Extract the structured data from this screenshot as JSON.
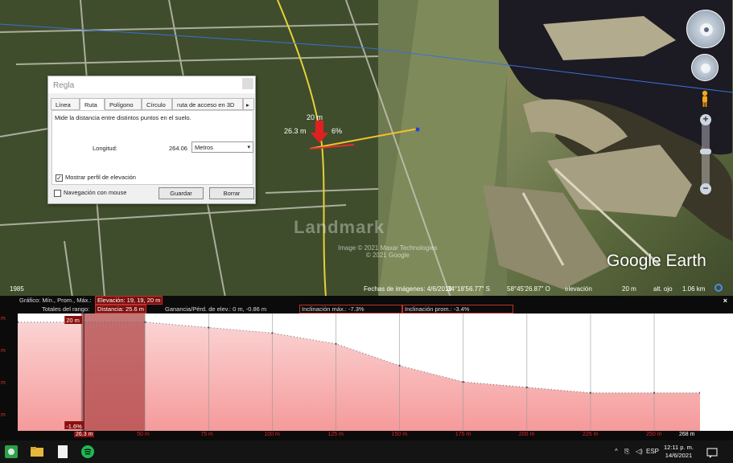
{
  "map": {
    "year": "1985",
    "attribution_line1": "Image © 2021 Maxar Technologies",
    "attribution_line2": "© 2021 Google",
    "watermark": "Landmark",
    "brand": "Google Earth",
    "status_date": "Fechas de imágenes: 4/6/2019",
    "status_lat": "34°18'56.77\" S",
    "status_lon": "58°45'26.87\" O",
    "status_elev_label": "elevación",
    "status_elev_value": "20 m",
    "status_alt_label": "alt. ojo",
    "status_alt_value": "1.06 km",
    "path_labels": {
      "top": "20 m",
      "left": "26.3 m",
      "right": "6%"
    }
  },
  "ruler": {
    "title": "Regla",
    "tabs": [
      "Línea",
      "Ruta",
      "Polígono",
      "Círculo",
      "ruta de acceso en 3D"
    ],
    "active_tab": "Ruta",
    "description": "Mide la distancia entre distintos puntos en el suelo.",
    "length_label": "Longitud:",
    "length_value": "264.06",
    "unit": "Metros",
    "show_profile_label": "Mostrar perfil de elevación",
    "show_profile_checked": true,
    "mouse_nav_label": "Navegación con mouse",
    "mouse_nav_checked": false,
    "save_label": "Guardar",
    "clear_label": "Borrar"
  },
  "profile": {
    "row1_label": "Gráfico: Mín., Prom., Máx.:",
    "row1_value": "Elevación: 19, 19, 20 m",
    "row2_label": "Totales del rango:",
    "distance": "Distancia: 25.6 m",
    "gain_loss": "Ganancia/Pérd. de elev.: 0 m, -0.86 m",
    "max_slope": "Inclinación máx.: -7.3%",
    "avg_slope": "Inclinación prom.: -3.4%",
    "close": "×",
    "cursor_top_label": "20 m",
    "cursor_bottom_label": "-1.6%",
    "cursor_distance": "26.3 m",
    "y_ticks": [
      "m",
      "m",
      "m",
      "m"
    ],
    "x_axis_labels": [
      "50 m",
      "75 m",
      "100 m",
      "125 m",
      "150 m",
      "175 m",
      "200 m",
      "225 m",
      "250 m",
      "268 m"
    ]
  },
  "chart_data": {
    "type": "area",
    "title": "",
    "xlabel": "",
    "ylabel": "",
    "x": [
      0,
      25,
      50,
      75,
      100,
      125,
      150,
      175,
      200,
      225,
      250,
      268
    ],
    "y": [
      20,
      20,
      20,
      19.9,
      19.8,
      19.6,
      19.2,
      18.9,
      18.8,
      18.7,
      18.7,
      18.7
    ],
    "xlim": [
      0,
      268
    ],
    "ylim": [
      18,
      20.1
    ],
    "fill_color": "#f5b8b8",
    "selection_range": [
      25,
      50
    ]
  },
  "taskbar": {
    "lang": "ESP",
    "time": "12:11 p. m.",
    "date": "14/6/2021"
  }
}
